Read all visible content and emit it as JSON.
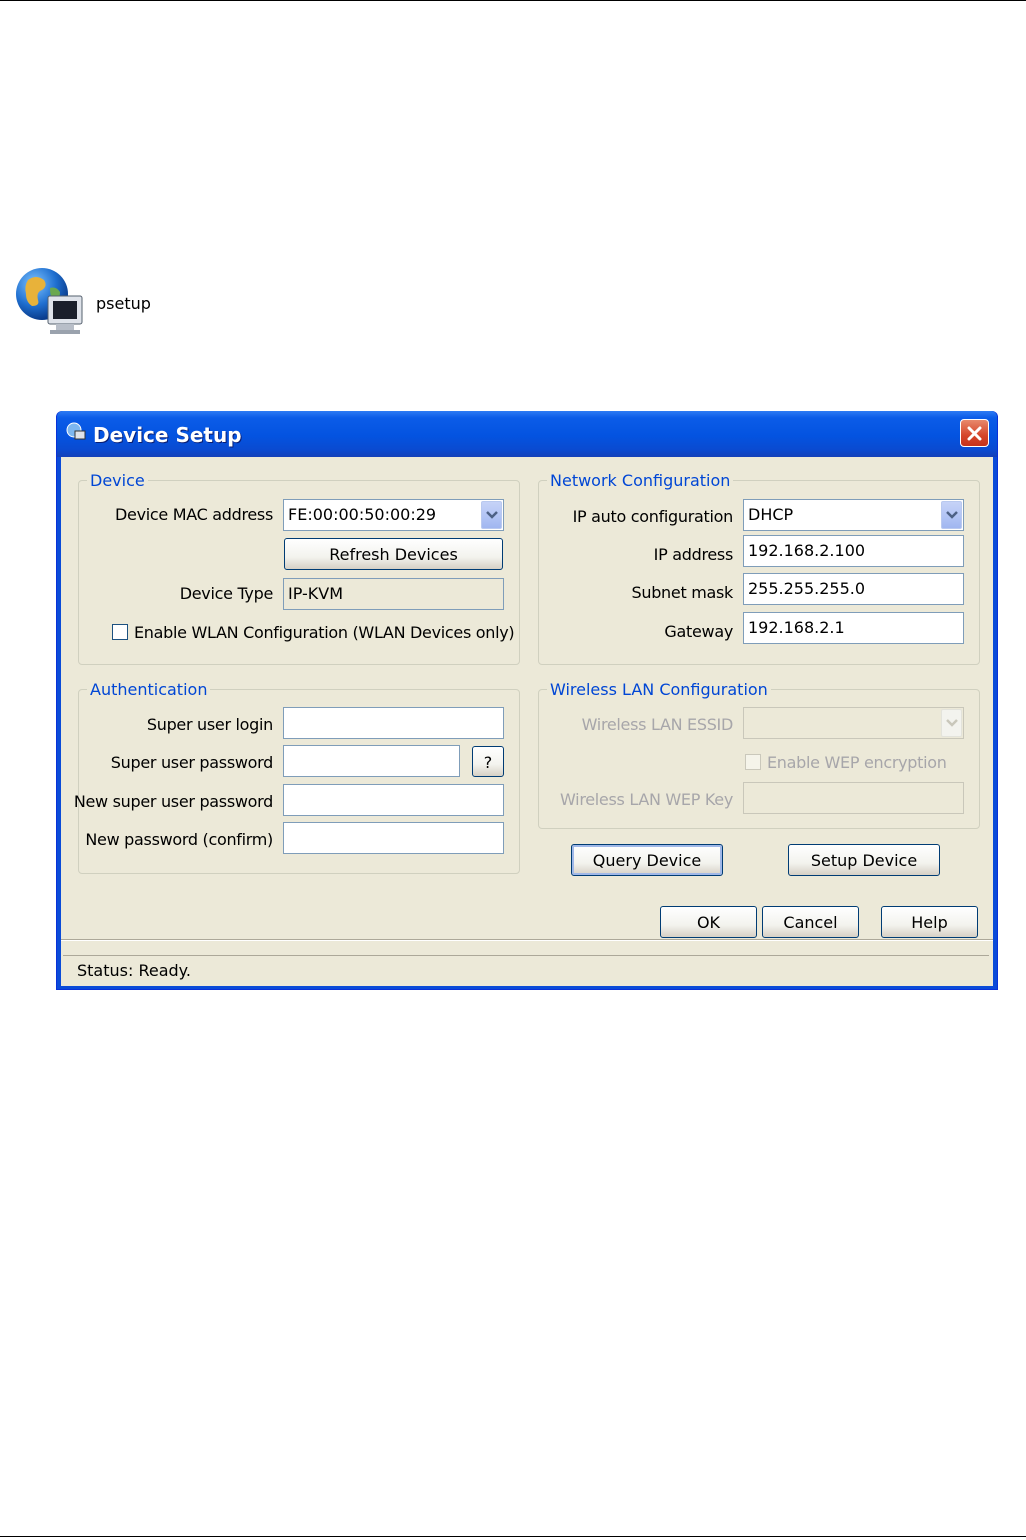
{
  "shortcut": {
    "label": "psetup",
    "icon": "globe-monitor-icon"
  },
  "window": {
    "title": "Device Setup",
    "close_icon": "close-icon",
    "device_group": {
      "legend": "Device",
      "mac_label": "Device MAC address",
      "mac_value": "FE:00:00:50:00:29",
      "refresh_button": "Refresh Devices",
      "type_label": "Device Type",
      "type_value": "IP-KVM",
      "wlan_checkbox_label": "Enable WLAN Configuration (WLAN Devices only)",
      "wlan_checked": false
    },
    "network_group": {
      "legend": "Network Configuration",
      "auto_label": "IP auto configuration",
      "auto_value": "DHCP",
      "ip_label": "IP address",
      "ip_value": "192.168.2.100",
      "subnet_label": "Subnet mask",
      "subnet_value": "255.255.255.0",
      "gateway_label": "Gateway",
      "gateway_value": "192.168.2.1"
    },
    "auth_group": {
      "legend": "Authentication",
      "login_label": "Super user login",
      "login_value": "",
      "password_label": "Super user password",
      "password_value": "",
      "help_button": "?",
      "new_password_label": "New super user password",
      "new_password_value": "",
      "confirm_label": "New password (confirm)",
      "confirm_value": ""
    },
    "wireless_group": {
      "legend": "Wireless LAN Configuration",
      "essid_label": "Wireless LAN ESSID",
      "essid_value": "",
      "wep_checkbox_label": "Enable WEP encryption",
      "wep_checked": false,
      "wep_key_label": "Wireless LAN WEP Key",
      "wep_key_value": ""
    },
    "query_button": "Query Device",
    "setup_button": "Setup Device",
    "ok_button": "OK",
    "cancel_button": "Cancel",
    "help_button": "Help",
    "status": "Status: Ready."
  }
}
